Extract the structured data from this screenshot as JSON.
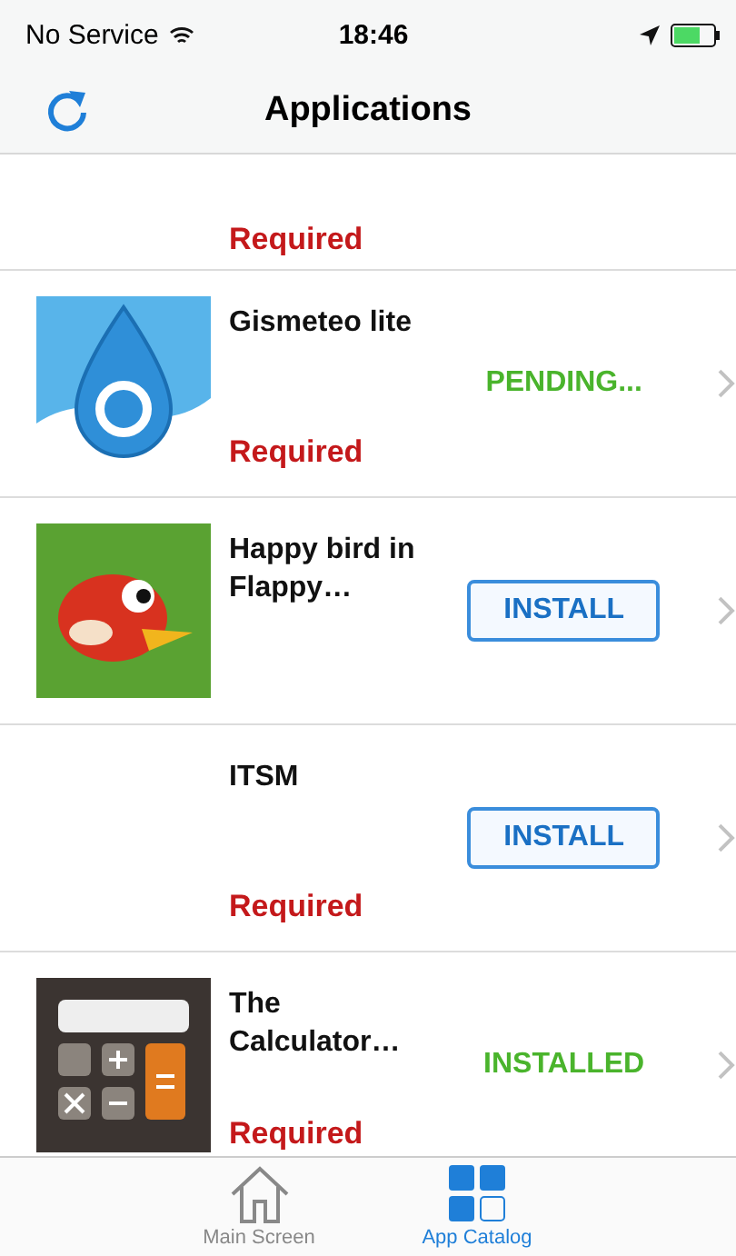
{
  "status_bar": {
    "carrier": "No Service",
    "time": "18:46"
  },
  "nav": {
    "title": "Applications"
  },
  "apps": [
    {
      "action": {
        "kind": "none"
      },
      "tag": "Required"
    },
    {
      "name": "Gismeteo lite",
      "action": {
        "kind": "pending",
        "text": "PENDING..."
      },
      "tag": "Required"
    },
    {
      "name": "Happy bird in Flappy…",
      "action": {
        "kind": "button",
        "text": "INSTALL"
      }
    },
    {
      "name": "ITSM",
      "action": {
        "kind": "button",
        "text": "INSTALL"
      },
      "tag": "Required"
    },
    {
      "name": "The Calculator…",
      "action": {
        "kind": "installed",
        "text": "INSTALLED"
      },
      "tag": "Required"
    }
  ],
  "tabs": [
    {
      "label": "Main Screen",
      "selected": false
    },
    {
      "label": "App Catalog",
      "selected": true
    }
  ]
}
